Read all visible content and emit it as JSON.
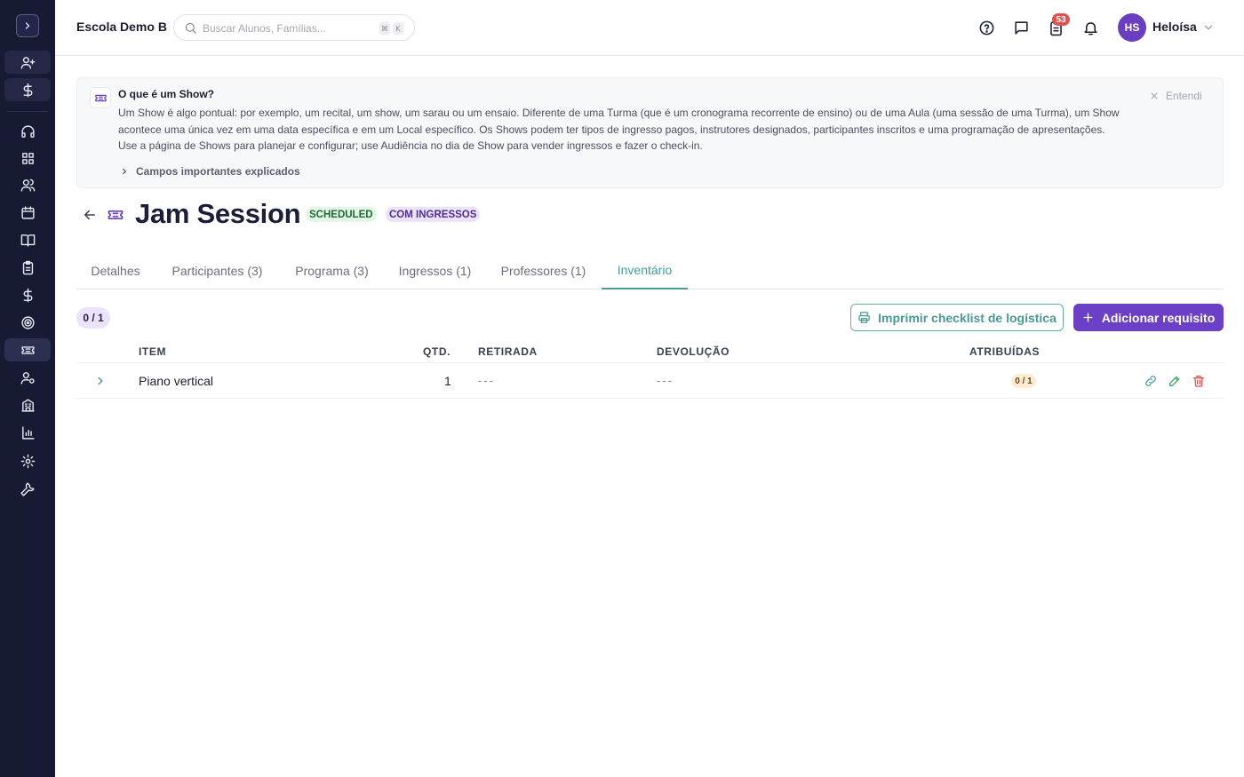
{
  "header": {
    "school_name": "Escola Demo B",
    "search_placeholder": "Buscar Alunos, Famílias...",
    "kbd_cmd": "⌘",
    "kbd_k": "K",
    "tasks_count": "53",
    "user_initials": "HS",
    "user_name": "Heloísa"
  },
  "sidebar": {
    "items": [
      "add-user",
      "dollar",
      "headset",
      "grid",
      "users",
      "calendar",
      "book",
      "clipboard",
      "dollar-2",
      "target",
      "ticket",
      "user-gear",
      "building",
      "chart",
      "settings",
      "wrench"
    ],
    "active": "ticket"
  },
  "info": {
    "title": "O que é um Show?",
    "body": "Um Show é algo pontual: por exemplo, um recital, um show, um sarau ou um ensaio. Diferente de uma Turma (que é um cronograma recorrente de ensino) ou de uma Aula (uma sessão de uma Turma), um Show acontece uma única vez em uma data específica e em um Local específico. Os Shows podem ter tipos de ingresso pagos, instrutores designados, participantes inscritos e uma programação de apresentações. Use a página de Shows para planejar e configurar; use Audiência no dia de Show para vender ingressos e fazer o check-in.",
    "dismiss": "Entendi",
    "more": "Campos importantes explicados"
  },
  "page": {
    "title": "Jam Session",
    "badge_status": "SCHEDULED",
    "badge_tickets": "COM INGRESSOS"
  },
  "tabs": [
    "Detalhes",
    "Participantes (3)",
    "Programa (3)",
    "Ingressos (1)",
    "Professores (1)",
    "Inventário"
  ],
  "active_tab": "Inventário",
  "toolbar": {
    "count": "0 / 1",
    "print_label": "Imprimir checklist de logística",
    "add_label": "Adicionar requisito"
  },
  "table": {
    "headers": {
      "item": "ITEM",
      "qty": "QTD.",
      "pickup": "RETIRADA",
      "return": "DEVOLUÇÃO",
      "assigned": "ATRIBUÍDAS"
    },
    "rows": [
      {
        "item": "Piano vertical",
        "qty": "1",
        "pickup": "---",
        "return": "---",
        "assigned": "0 / 1"
      }
    ]
  },
  "colors": {
    "sidebar_bg": "#161a33",
    "accent_purple": "#6b3fc6",
    "accent_teal": "#4a9a9a",
    "danger": "#e05252"
  }
}
